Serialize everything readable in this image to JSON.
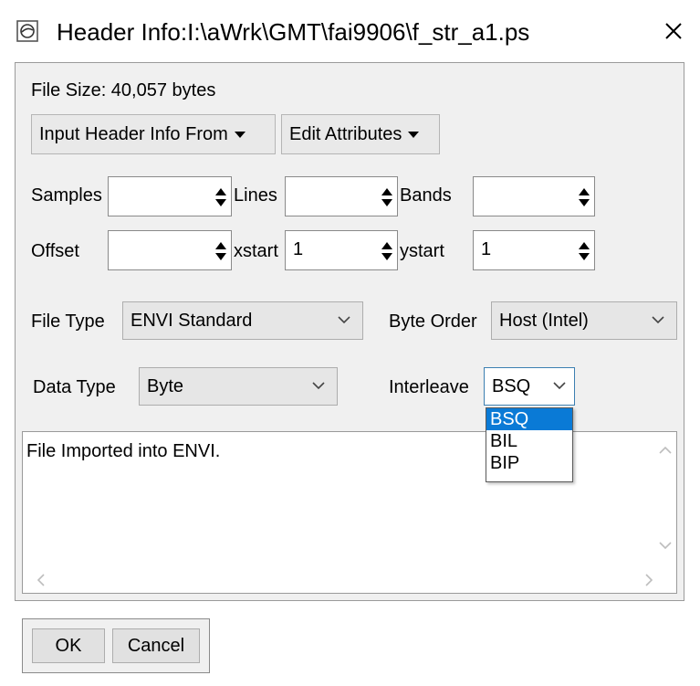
{
  "window": {
    "title": "Header Info:I:\\aWrk\\GMT\\fai9906\\f_str_a1.ps",
    "app_icon": "envi-app-icon",
    "close_icon": "close-icon"
  },
  "file_size": "File Size: 40,057 bytes",
  "menus": {
    "input_header": "Input Header Info From",
    "edit_attributes": "Edit Attributes"
  },
  "fields": {
    "samples": {
      "label": "Samples",
      "value": ""
    },
    "lines": {
      "label": "Lines",
      "value": ""
    },
    "bands": {
      "label": "Bands",
      "value": ""
    },
    "offset": {
      "label": "Offset",
      "value": ""
    },
    "xstart": {
      "label": "xstart",
      "value": "1"
    },
    "ystart": {
      "label": "ystart",
      "value": "1"
    }
  },
  "combos": {
    "file_type": {
      "label": "File Type",
      "value": "ENVI Standard"
    },
    "byte_order": {
      "label": "Byte Order",
      "value": "Host (Intel)"
    },
    "data_type": {
      "label": "Data Type",
      "value": "Byte"
    },
    "interleave": {
      "label": "Interleave",
      "value": "BSQ",
      "options": [
        "BSQ",
        "BIL",
        "BIP"
      ]
    }
  },
  "description": "File Imported into ENVI.",
  "buttons": {
    "ok": "OK",
    "cancel": "Cancel"
  },
  "colors": {
    "selection": "#0a7ad6",
    "panel": "#f0f0f0"
  }
}
